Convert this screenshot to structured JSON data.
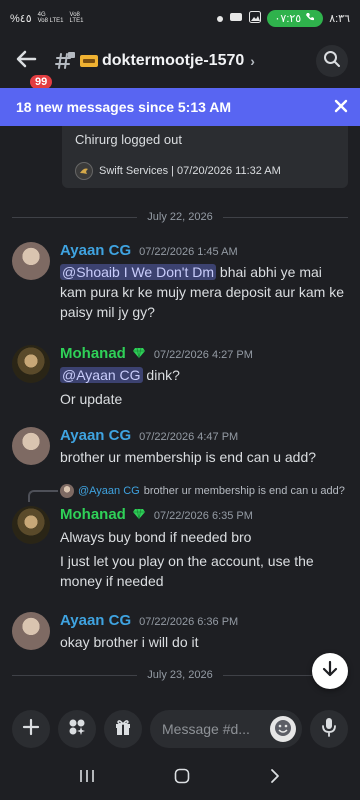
{
  "status_bar": {
    "left_text": "%٤٥",
    "carrier_1": "4G",
    "carrier_1_sub": "Vo8 LTE1",
    "carrier_2": "Vo8",
    "carrier_2_sub": "LTE1",
    "call_timer": "٠٧:٢٥",
    "clock": "٨:٣٦"
  },
  "header": {
    "unread_badge": "99",
    "channel_name": "doktermootje-1570"
  },
  "banner": {
    "text": "18 new messages since 5:13 AM"
  },
  "embed": {
    "text": "Chirurg logged out",
    "footer": "Swift Services | 07/20/2026 11:32 AM"
  },
  "dividers": {
    "first": "July 22, 2026",
    "second": "July 23, 2026"
  },
  "messages": [
    {
      "author": "Ayaan CG",
      "time": "07/22/2026 1:45 AM",
      "mention": "@Shoaib I We Don't Dm",
      "text": " bhai abhi ye mai kam pura kr ke mujy mera deposit aur kam ke paisy mil jy gy?"
    },
    {
      "author": "Mohanad",
      "time": "07/22/2026 4:27 PM",
      "mention": "@Ayaan CG",
      "text": " dink?",
      "line2": "Or update"
    },
    {
      "author": "Ayaan CG",
      "time": "07/22/2026 4:47 PM",
      "text": "brother ur membership is end can u add?"
    },
    {
      "author": "Mohanad",
      "time": "07/22/2026 6:35 PM",
      "reply_to_name": "@Ayaan CG",
      "reply_to_text": "brother ur membership is end can u add?",
      "text": "Always buy bond if needed bro",
      "line2": "I just let you play on the account, use the money if needed"
    },
    {
      "author": "Ayaan CG",
      "time": "07/22/2026 6:36 PM",
      "text": "okay brother i will do it"
    }
  ],
  "composer": {
    "placeholder": "Message #d..."
  },
  "colors": {
    "accent": "#5865f2",
    "ayaan_name": "#3fa3e0",
    "mohanad_name": "#2fd158",
    "badge": "#e33d41"
  }
}
